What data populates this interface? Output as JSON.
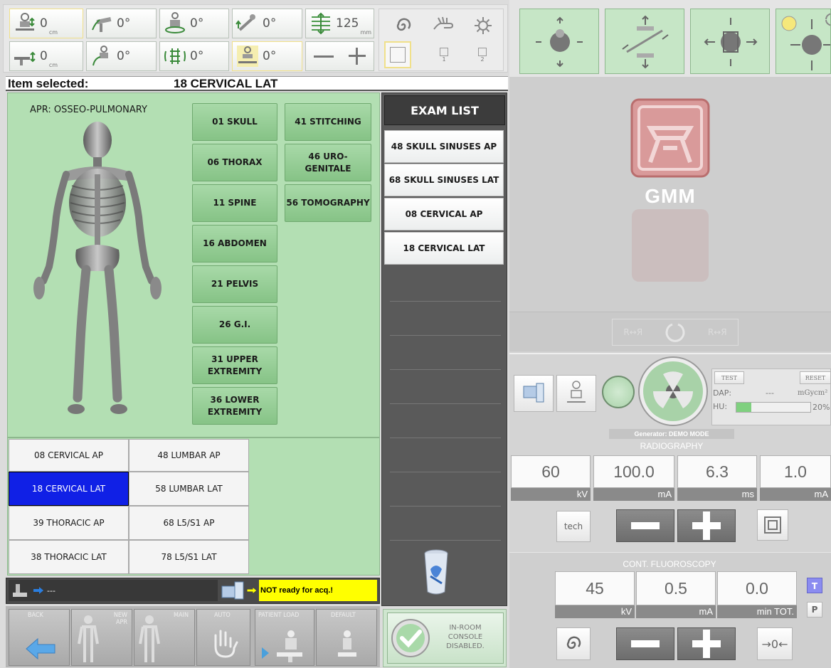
{
  "toolbar": {
    "height_value": "0",
    "height_unit": "cm",
    "tilt1": "0°",
    "tilt2": "0°",
    "tilt3": "0°",
    "sid_value": "125",
    "sid_unit": "mm",
    "lower_height_value": "0",
    "lower_height_unit": "cm",
    "tilt4": "0°",
    "tilt5": "0°",
    "tilt6": "0°",
    "slot1": "1",
    "slot2": "2"
  },
  "selection": {
    "label": "Item selected:",
    "value": "18 CERVICAL  LAT"
  },
  "apr": {
    "title": "APR: OSSEO-PULMONARY"
  },
  "anatomy": [
    {
      "label": "01 SKULL"
    },
    {
      "label": "06 THORAX"
    },
    {
      "label": "11 SPINE"
    },
    {
      "label": "16 ABDOMEN"
    },
    {
      "label": "21 PELVIS"
    },
    {
      "label": "26 G.I."
    },
    {
      "label": "31 UPPER EXTREMITY"
    },
    {
      "label": "36 LOWER EXTREMITY"
    },
    {
      "label": "41 STITCHING"
    },
    {
      "label": "46 URO-GENITALE"
    },
    {
      "label": "56 TOMOGRAPHY"
    }
  ],
  "projections": [
    {
      "label": "08 CERVICAL  AP"
    },
    {
      "label": "48 LUMBAR  AP"
    },
    {
      "label": "18 CERVICAL  LAT"
    },
    {
      "label": "58 LUMBAR  LAT"
    },
    {
      "label": "39 THORACIC  AP"
    },
    {
      "label": "68 L5/S1 AP"
    },
    {
      "label": "38 THORACIC  LAT"
    },
    {
      "label": "78 L5/S1 LAT"
    }
  ],
  "exam_list": {
    "title": "EXAM LIST",
    "items": [
      {
        "label": "48 SKULL SINUSES AP"
      },
      {
        "label": "68 SKULL SINUSES LAT"
      },
      {
        "label": "08 CERVICAL  AP"
      },
      {
        "label": "18 CERVICAL  LAT"
      }
    ]
  },
  "status": {
    "left": "---",
    "right": "NOT ready for acq.!"
  },
  "nav": {
    "back": "BACK",
    "new_apr": "NEW APR",
    "main": "MAIN",
    "auto": "AUTO",
    "patient_load": "PATIENT LOAD",
    "default": "DEFAULT"
  },
  "console": {
    "text": "IN-ROOM CONSOLE DISABLED."
  },
  "logo": {
    "text": "GMM"
  },
  "dap": {
    "test": "TEST",
    "reset": "RESET",
    "dap_label": "DAP:",
    "dap_value": "---",
    "dap_unit": "mGycm²",
    "hu_label": "HU:",
    "hu_value": "20%",
    "hu_fraction": 0.2
  },
  "generator": {
    "mode": "Generator: DEMO MODE"
  },
  "radiography": {
    "title": "RADIOGRAPHY",
    "kv": "60",
    "kv_unit": "kV",
    "ma": "100.0",
    "ma_unit": "mA",
    "ms": "6.3",
    "ms_unit": "ms",
    "mas": "1.0",
    "mas_unit": "mA",
    "tech": "tech"
  },
  "fluoro": {
    "title": "CONT. FLUOROSCOPY",
    "kv": "45",
    "kv_unit": "kV",
    "ma": "0.5",
    "ma_unit": "mA",
    "min": "0.0",
    "min_unit": "min TOT.",
    "t": "T",
    "p": "P",
    "zero": "→0←"
  },
  "colors": {
    "selected": "#1020e6",
    "panel_green": "#b3dfb3",
    "button_green": "#8fc98f",
    "status_yellow": "#ffff00"
  }
}
